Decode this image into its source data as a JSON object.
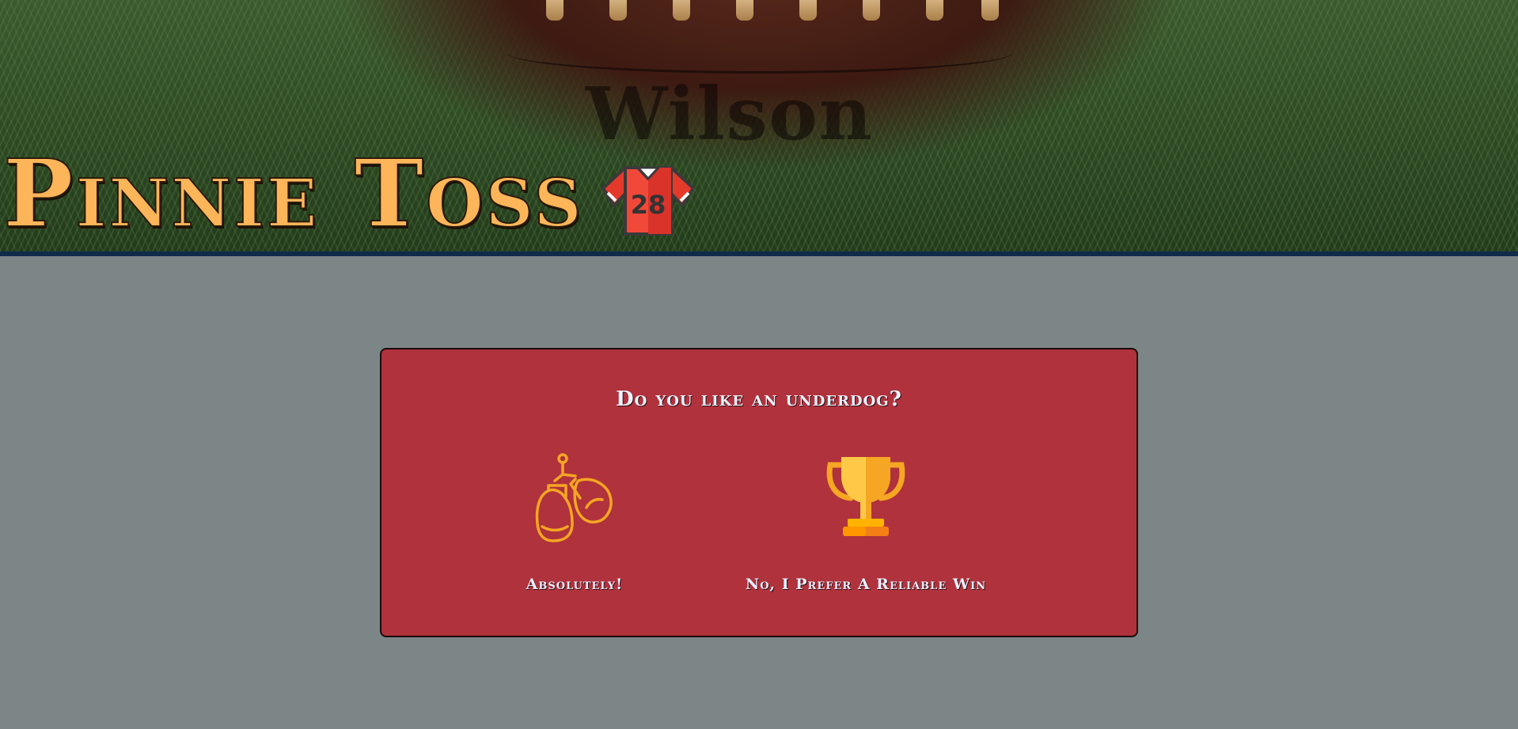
{
  "header": {
    "title": "Pinnie Toss",
    "jersey_number": "28",
    "ball_brand": "Wilson"
  },
  "quiz": {
    "question": "Do you like an underdog?",
    "options": [
      {
        "label": "Absolutely!",
        "icon": "boxing-gloves-icon"
      },
      {
        "label": "No, I Prefer A Reliable Win",
        "icon": "trophy-icon"
      }
    ]
  },
  "colors": {
    "page_background": "#7d8686",
    "card_background": "#b0323c",
    "title_color": "#fdb55a",
    "header_border": "#0f2a4a",
    "icon_orange": "#f5a623"
  }
}
